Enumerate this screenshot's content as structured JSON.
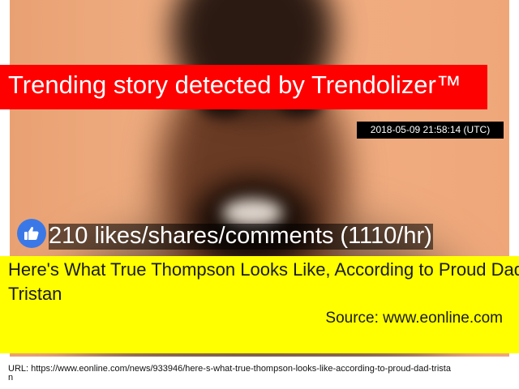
{
  "banner": {
    "text": "Trending story detected by Trendolizer™",
    "color": "#ff0000"
  },
  "timestamp": "2018-05-09 21:58:14 (UTC)",
  "engagement": {
    "icon": "thumbs-up-icon",
    "text": "210 likes/shares/comments (1110/hr)"
  },
  "story": {
    "headline": "Here's What True Thompson Looks Like, According to Proud Dad Tristan",
    "source": "Source: www.eonline.com",
    "highlight_color": "#ffff00"
  },
  "url": "URL: https://www.eonline.com/news/933946/here-s-what-true-thompson-looks-like-according-to-proud-dad-tristan"
}
